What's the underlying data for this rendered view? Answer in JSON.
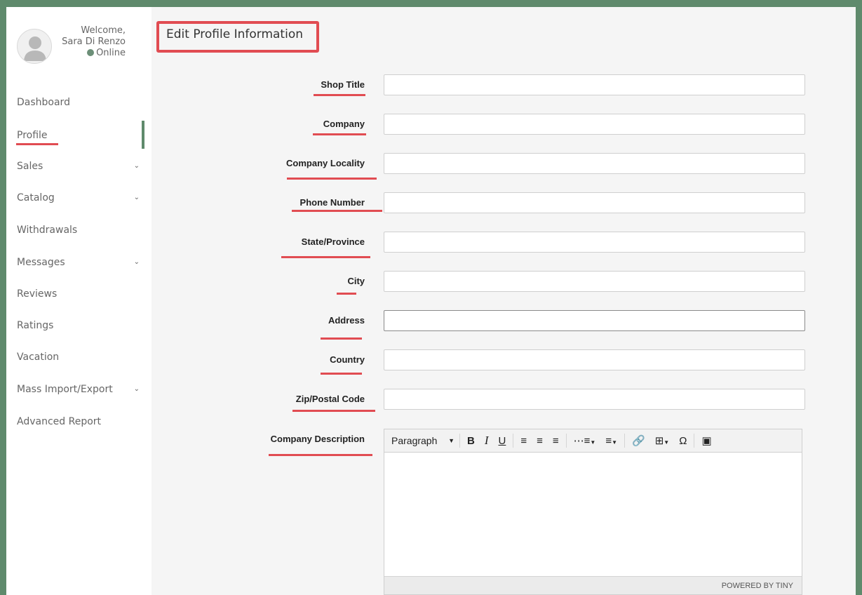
{
  "user": {
    "welcome": "Welcome,",
    "name": "Sara Di Renzo",
    "status": "Online"
  },
  "sidebar": {
    "items": [
      {
        "label": "Dashboard",
        "has_chevron": false
      },
      {
        "label": "Profile",
        "has_chevron": false,
        "active": true
      },
      {
        "label": "Sales",
        "has_chevron": true
      },
      {
        "label": "Catalog",
        "has_chevron": true
      },
      {
        "label": "Withdrawals",
        "has_chevron": false
      },
      {
        "label": "Messages",
        "has_chevron": true
      },
      {
        "label": "Reviews",
        "has_chevron": false
      },
      {
        "label": "Ratings",
        "has_chevron": false
      },
      {
        "label": "Vacation",
        "has_chevron": false
      },
      {
        "label": "Mass Import/Export",
        "has_chevron": true
      },
      {
        "label": "Advanced Report",
        "has_chevron": false
      }
    ]
  },
  "main": {
    "title": "Edit Profile Information",
    "fields": [
      {
        "label": "Shop Title",
        "value": ""
      },
      {
        "label": "Company",
        "value": ""
      },
      {
        "label": "Company Locality",
        "value": ""
      },
      {
        "label": "Phone Number",
        "value": ""
      },
      {
        "label": "State/Province",
        "value": ""
      },
      {
        "label": "City",
        "value": ""
      },
      {
        "label": "Address",
        "value": ""
      },
      {
        "label": "Country",
        "value": ""
      },
      {
        "label": "Zip/Postal Code",
        "value": ""
      }
    ],
    "description_label": "Company Description",
    "editor": {
      "block_format": "Paragraph",
      "powered_by": "POWERED BY TINY"
    }
  },
  "colors": {
    "frame": "#5f8a6c",
    "highlight": "#e14c52",
    "main_bg": "#f5f5f5"
  }
}
